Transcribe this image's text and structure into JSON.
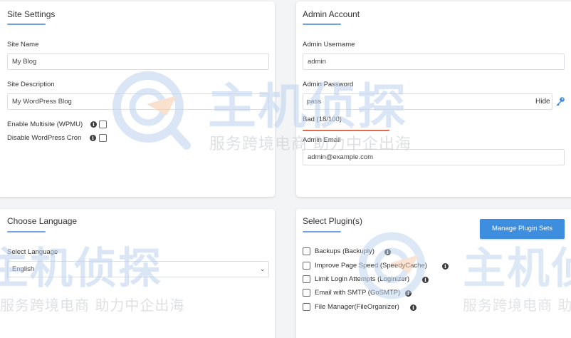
{
  "site_settings": {
    "title": "Site Settings",
    "site_name_label": "Site Name",
    "site_name_value": "My Blog",
    "site_description_label": "Site Description",
    "site_description_value": "My WordPress Blog",
    "multisite_label": "Enable Multisite (WPMU)",
    "disable_cron_label": "Disable WordPress Cron",
    "info_icon": "info-icon"
  },
  "admin_account": {
    "title": "Admin Account",
    "username_label": "Admin Username",
    "username_value": "admin",
    "password_label": "Admin Password",
    "password_value": "pass",
    "hide_label": "Hide",
    "key_icon": "key-icon",
    "strength_text": "Bad (18/100)",
    "strength_color": "#e46c4a",
    "email_label": "Admin Email",
    "email_value": "admin@example.com"
  },
  "choose_language": {
    "title": "Choose Language",
    "select_label": "Select Language",
    "selected_value": "English"
  },
  "select_plugins": {
    "title": "Select Plugin(s)",
    "manage_button_label": "Manage Plugin Sets",
    "plugins": [
      {
        "label": "Backups (Backuply)"
      },
      {
        "label": "Improve Page Speed (SpeedyCache)"
      },
      {
        "label": "Limit Login Attempts (Loginizer)"
      },
      {
        "label": "Email with SMTP (GoSMTP)"
      },
      {
        "label": "File Manager(FileOrganizer)"
      }
    ]
  },
  "watermark": {
    "brand_text": "主机侦探",
    "slogan_text": "服务跨境电商 助力中企出海"
  },
  "colors": {
    "accent": "#3e8ee0",
    "underline": "#6ea2de",
    "watermark": "#bcd3ef"
  }
}
